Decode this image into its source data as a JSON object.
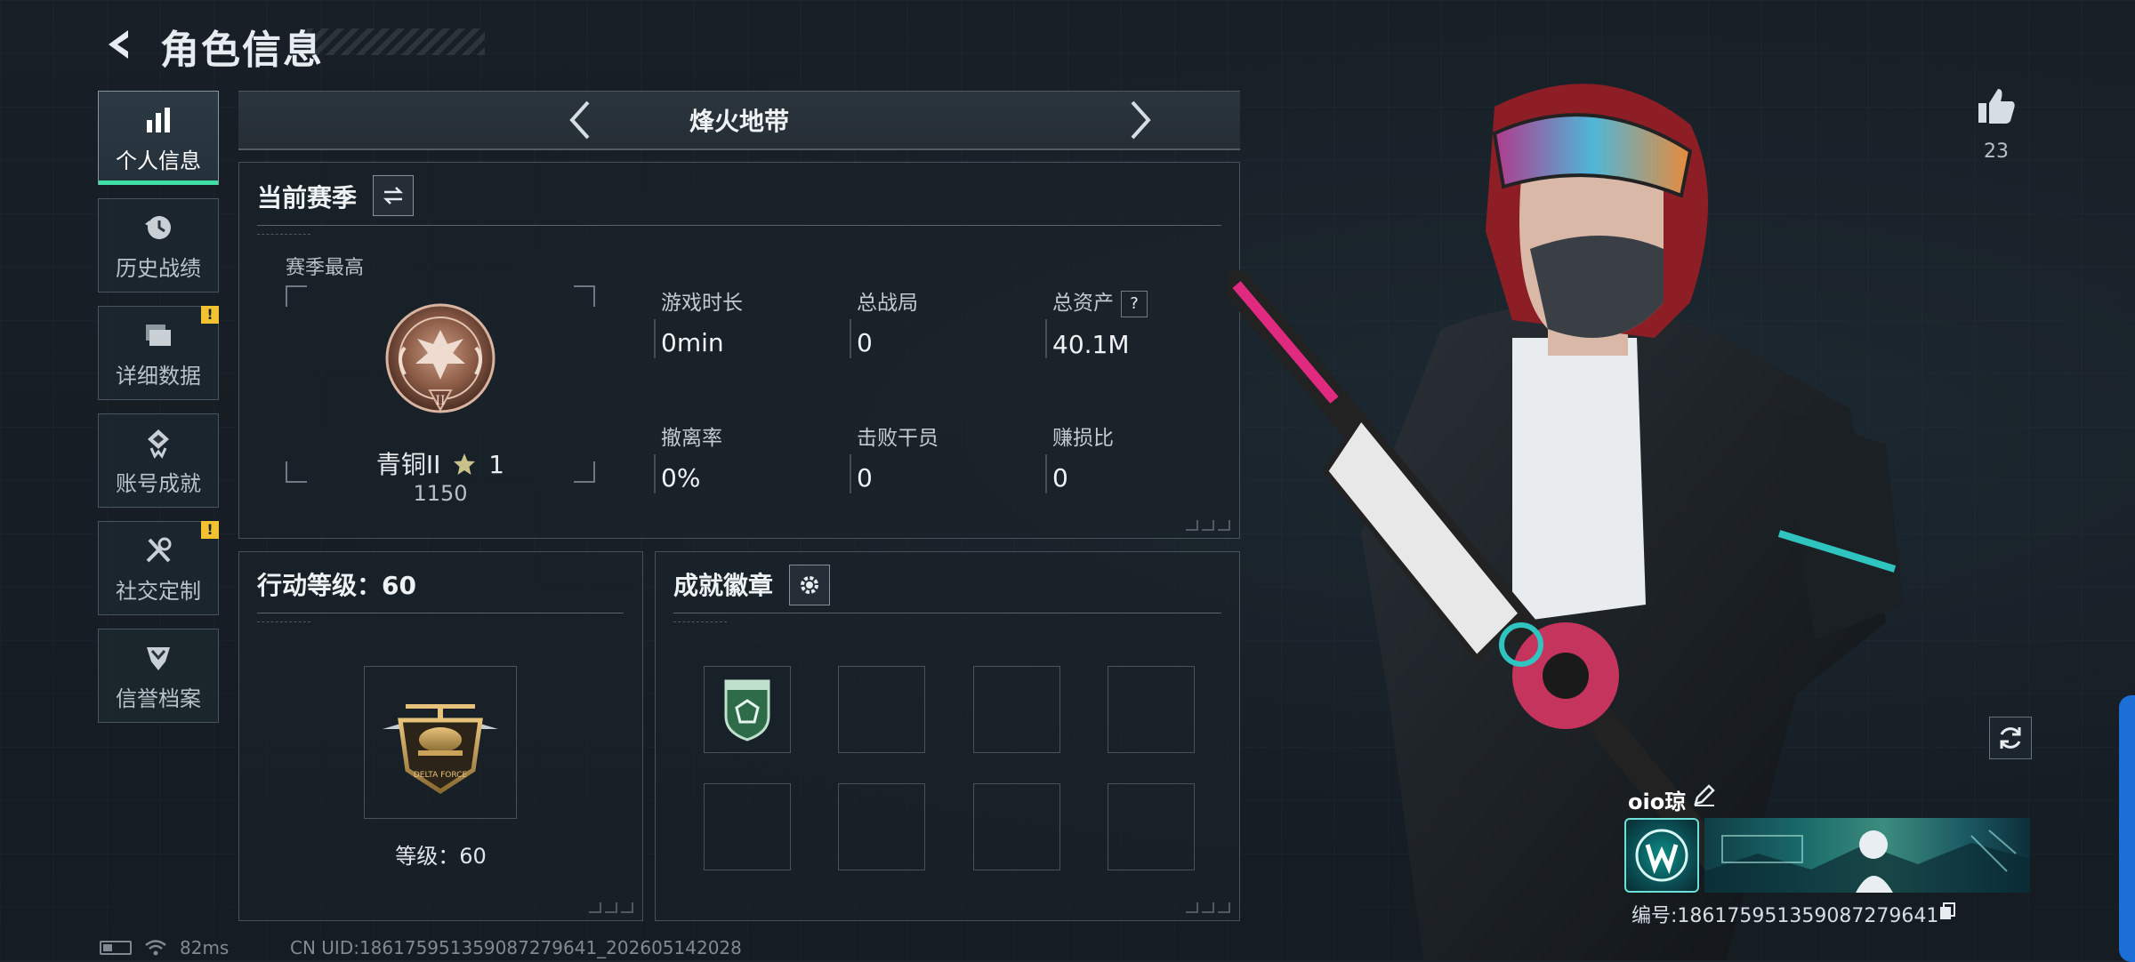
{
  "header": {
    "title": "角色信息"
  },
  "nav": {
    "items": [
      {
        "label": "个人信息",
        "icon": "bar-chart-icon",
        "active": true,
        "alert": false
      },
      {
        "label": "历史战绩",
        "icon": "history-clock-icon",
        "active": false,
        "alert": false
      },
      {
        "label": "详细数据",
        "icon": "folder-stack-icon",
        "active": false,
        "alert": true
      },
      {
        "label": "账号成就",
        "icon": "diamond-award-icon",
        "active": false,
        "alert": false
      },
      {
        "label": "社交定制",
        "icon": "wrench-tools-icon",
        "active": false,
        "alert": true
      },
      {
        "label": "信誉档案",
        "icon": "shield-chevron-icon",
        "active": false,
        "alert": false
      }
    ],
    "alert_mark": "!"
  },
  "mode": {
    "title": "烽火地带"
  },
  "season": {
    "title": "当前赛季",
    "best_label": "赛季最高",
    "rank_name": "青铜II",
    "rank_stars": "1",
    "rank_score": "1150",
    "stats": [
      {
        "label": "游戏时长",
        "value": "0min"
      },
      {
        "label": "总战局",
        "value": "0"
      },
      {
        "label": "总资产",
        "value": "40.1M",
        "help": "?"
      },
      {
        "label": "撤离率",
        "value": "0%"
      },
      {
        "label": "击败干员",
        "value": "0"
      },
      {
        "label": "赚损比",
        "value": "0"
      }
    ]
  },
  "level": {
    "title": "行动等级：60",
    "label": "等级：60"
  },
  "badges": {
    "title": "成就徽章"
  },
  "social": {
    "likes": "23"
  },
  "player": {
    "name": "oio琼",
    "id": "编号:1861759513590872796​41"
  },
  "status": {
    "ping": "82ms",
    "uid": "CN UID:1861759513590872796​41_202605142028"
  },
  "colors": {
    "accent": "#3fe0a8",
    "alert": "#f2c230",
    "blue_tab": "#1d6fd8"
  }
}
